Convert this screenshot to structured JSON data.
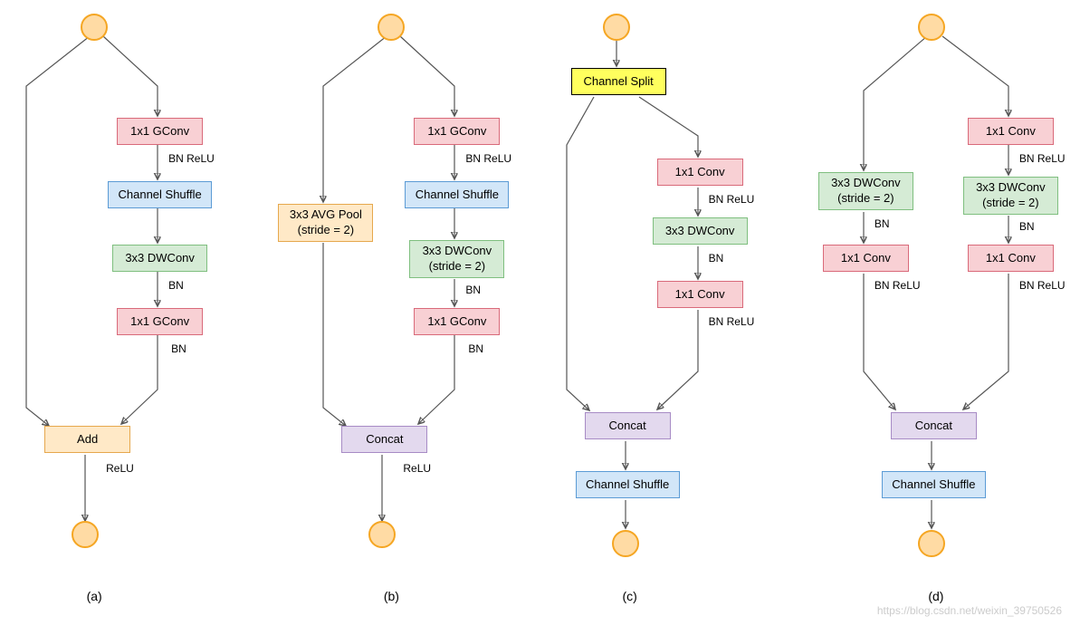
{
  "diagrams": {
    "a": {
      "caption": "(a)",
      "blocks": {
        "gconv1": "1x1 GConv",
        "shuffle": "Channel Shuffle",
        "dwconv": "3x3 DWConv",
        "gconv2": "1x1 GConv",
        "merge": "Add"
      },
      "annotations": {
        "bn_relu1": "BN ReLU",
        "bn1": "BN",
        "bn2": "BN",
        "relu_out": "ReLU"
      }
    },
    "b": {
      "caption": "(b)",
      "blocks": {
        "avgpool": "3x3 AVG Pool\n(stride = 2)",
        "gconv1": "1x1 GConv",
        "shuffle": "Channel Shuffle",
        "dwconv": "3x3 DWConv\n(stride = 2)",
        "gconv2": "1x1 GConv",
        "merge": "Concat"
      },
      "annotations": {
        "bn_relu1": "BN ReLU",
        "bn1": "BN",
        "bn2": "BN",
        "relu_out": "ReLU"
      }
    },
    "c": {
      "caption": "(c)",
      "blocks": {
        "split": "Channel Split",
        "conv1": "1x1 Conv",
        "dwconv": "3x3 DWConv",
        "conv2": "1x1 Conv",
        "merge": "Concat",
        "shuffle": "Channel Shuffle"
      },
      "annotations": {
        "bn_relu1": "BN ReLU",
        "bn1": "BN",
        "bn_relu2": "BN ReLU"
      }
    },
    "d": {
      "caption": "(d)",
      "blocks": {
        "dwconv_l": "3x3 DWConv\n(stride = 2)",
        "conv_l": "1x1 Conv",
        "conv1": "1x1 Conv",
        "dwconv_r": "3x3 DWConv\n(stride = 2)",
        "conv2": "1x1 Conv",
        "merge": "Concat",
        "shuffle": "Channel Shuffle"
      },
      "annotations": {
        "bn_l": "BN",
        "bn_relu_l": "BN ReLU",
        "bn_relu1": "BN ReLU",
        "bn_r": "BN",
        "bn_relu2": "BN ReLU"
      }
    }
  },
  "watermark": "https://blog.csdn.net/weixin_39750526"
}
